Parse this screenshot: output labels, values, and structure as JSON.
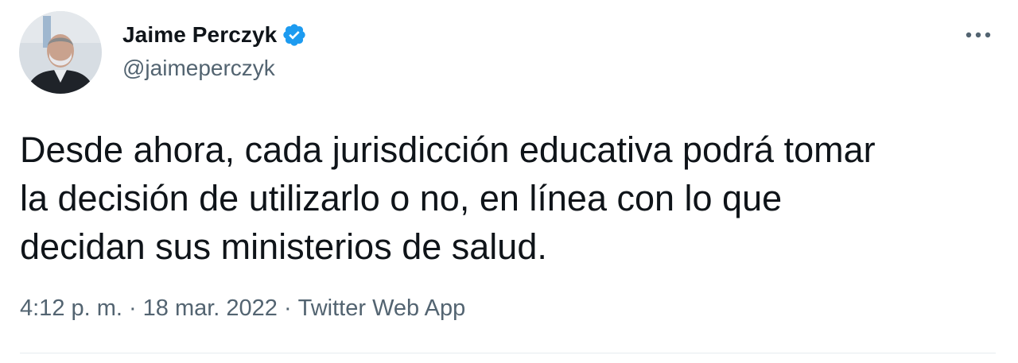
{
  "author": {
    "display_name": "Jaime Perczyk",
    "handle": "@jaimeperczyk",
    "verified": true,
    "avatar_icon": "profile-photo"
  },
  "tweet": {
    "text": "Desde ahora, cada jurisdicción educativa podrá tomar\nla decisión de utilizarlo o no, en línea con lo que\ndecidan sus ministerios de salud."
  },
  "meta": {
    "time": "4:12 p. m.",
    "separator": "·",
    "date": "18 mar. 2022",
    "source": "Twitter Web App"
  },
  "icons": {
    "verified": "verified-badge-icon",
    "more": "more-options-icon"
  },
  "colors": {
    "text": "#0f1419",
    "secondary": "#536471",
    "verified_blue": "#1d9bf0",
    "divider": "#e6ecf0"
  }
}
